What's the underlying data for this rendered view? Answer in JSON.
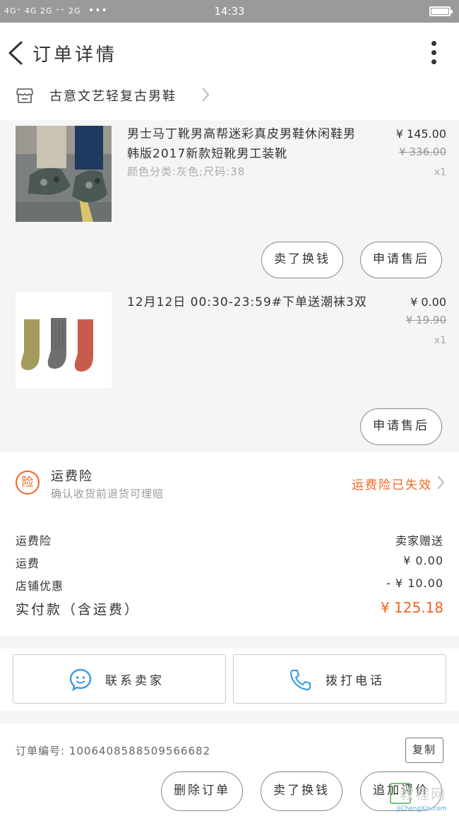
{
  "status_bar": {
    "signal": "4G⁺ 4G 2G ⁺⁺ 2G",
    "dots": "•••",
    "time": "14:33"
  },
  "header": {
    "title": "订单详情"
  },
  "shop": {
    "name": "古意文艺轻复古男鞋"
  },
  "items": [
    {
      "name": "男士马丁靴男高帮迷彩真皮男鞋休闲鞋男韩版2017新款短靴男工装靴",
      "sku": "颜色分类:灰色;尺码:38",
      "price": "¥ 145.00",
      "original_price": "¥ 336.00",
      "qty": "x1",
      "buttons": [
        "卖了换钱",
        "申请售后"
      ]
    },
    {
      "name": "12月12日 00:30-23:59#下单送潮袜3双",
      "price": "¥ 0.00",
      "original_price": "¥ 19.90",
      "qty": "x1",
      "buttons": [
        "申请售后"
      ]
    }
  ],
  "insurance": {
    "badge": "险",
    "title": "运费险",
    "subtitle": "确认收货前退货可理赔",
    "status": "运费险已失效"
  },
  "summary": {
    "rows": [
      {
        "label": "运费险",
        "value": "卖家赠送"
      },
      {
        "label": "运费",
        "value": "¥ 0.00"
      },
      {
        "label": "店铺优惠",
        "value": "- ¥ 10.00"
      }
    ],
    "total_label": "实付款（含运费）",
    "total_value": "¥ 125.18"
  },
  "contact": {
    "chat_label": "联系卖家",
    "call_label": "拨打电话"
  },
  "order": {
    "number_label": "订单编号: 1006408588509566682",
    "copy_label": "复制"
  },
  "bottom_bar": {
    "buttons": [
      "删除订单",
      "卖了换钱",
      "追加评价"
    ]
  },
  "watermark": {
    "text": "教程网",
    "url": "JiChengXin.com"
  },
  "colors": {
    "accent": "#f26522",
    "chat_blue": "#3aa0e0"
  }
}
